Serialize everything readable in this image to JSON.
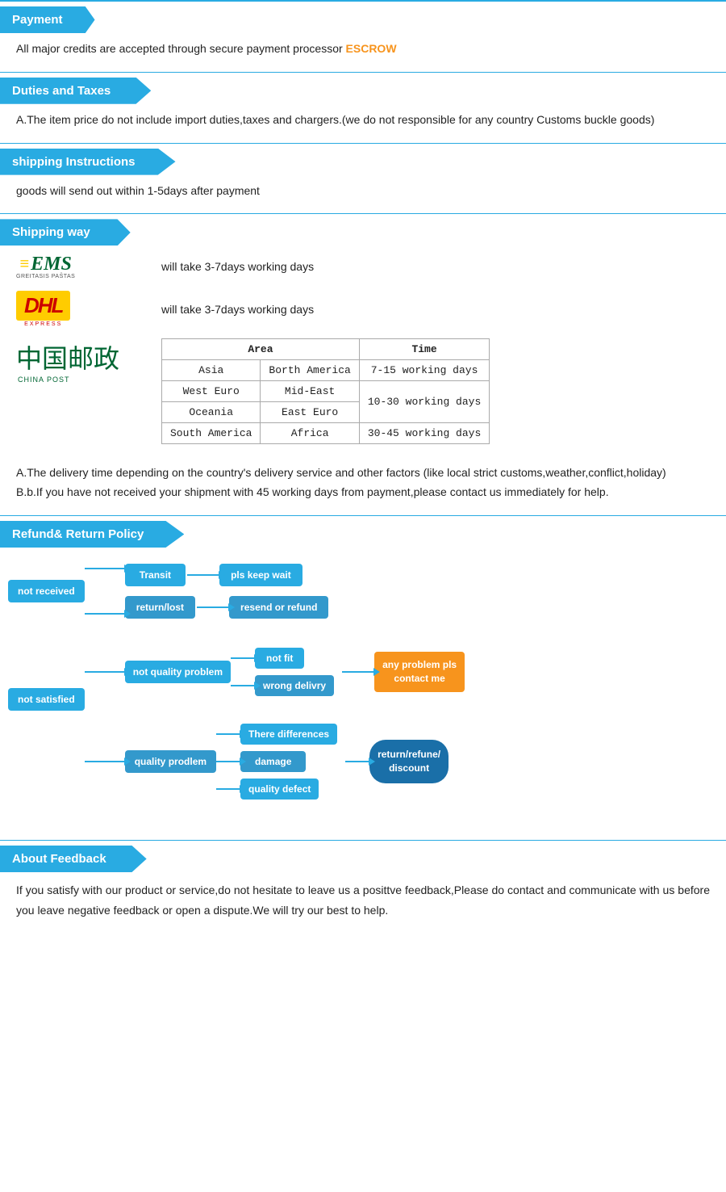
{
  "payment": {
    "title": "Payment",
    "text": "All  major  credits  are  accepted  through  secure  payment  processor",
    "escrow": "ESCROW"
  },
  "duties": {
    "title": "Duties  and  Taxes",
    "text": "A.The  item  price  do  not  include  import  duties,taxes  and  chargers.(we  do  not  responsible  for  any  country  Customs  buckle  goods)"
  },
  "shipping_instructions": {
    "title": "shipping  Instructions",
    "text": "goods  will  send  out  within  1-5days  after  payment"
  },
  "shipping_way": {
    "title": "Shipping  way",
    "ems_text": "will  take  3-7days  working  days",
    "dhl_text": "will  take  3-7days  working  days",
    "table": {
      "headers": [
        "Area",
        "Time"
      ],
      "rows": [
        {
          "area1": "Asia",
          "area2": "Borth  America",
          "time": "7-15 working days"
        },
        {
          "area1": "West  Euro",
          "area2": "Mid-East",
          "time": ""
        },
        {
          "area1": "Oceania",
          "area2": "East  Euro",
          "time": "10-30 working days"
        },
        {
          "area1": "South  America",
          "area2": "Africa",
          "time": "30-45 working days"
        }
      ]
    },
    "note_a": "A.The  delivery  time  depending  on  the  country's  delivery  service  and  other  factors  (like  local  strict  customs,weather,conflict,holiday)",
    "note_b": "B.b.If  you  have  not  received  your  shipment  with  45  working  days  from  payment,please  contact  us  immediately  for  help."
  },
  "refund": {
    "title": "Refund&  Return  Policy",
    "not_received": "not  received",
    "transit": "Transit",
    "pls_keep_wait": "pls  keep  wait",
    "return_lost": "return/lost",
    "resend_or_refund": "resend  or  refund",
    "not_satisfied": "not  satisfied",
    "not_quality_problem": "not  quality  problem",
    "not_fit": "not  fit",
    "wrong_delivry": "wrong  delivry",
    "quality_prodlem": "quality  prodlem",
    "there_differences": "There  differences",
    "damage": "damage",
    "quality_defect": "quality  defect",
    "any_problem": "any  problem  pls\ncontact  me",
    "return_refund": "return/refune/\ndiscount"
  },
  "feedback": {
    "title": "About  Feedback",
    "text": "If  you  satisfy  with  our  product  or  service,do  not  hesitate  to  leave  us  a  posittve  feedback,Please  do  contact  and  communicate  with  us  before  you  leave  negative  feedback  or  open  a  dispute.We  will  try  our  best  to  help."
  }
}
